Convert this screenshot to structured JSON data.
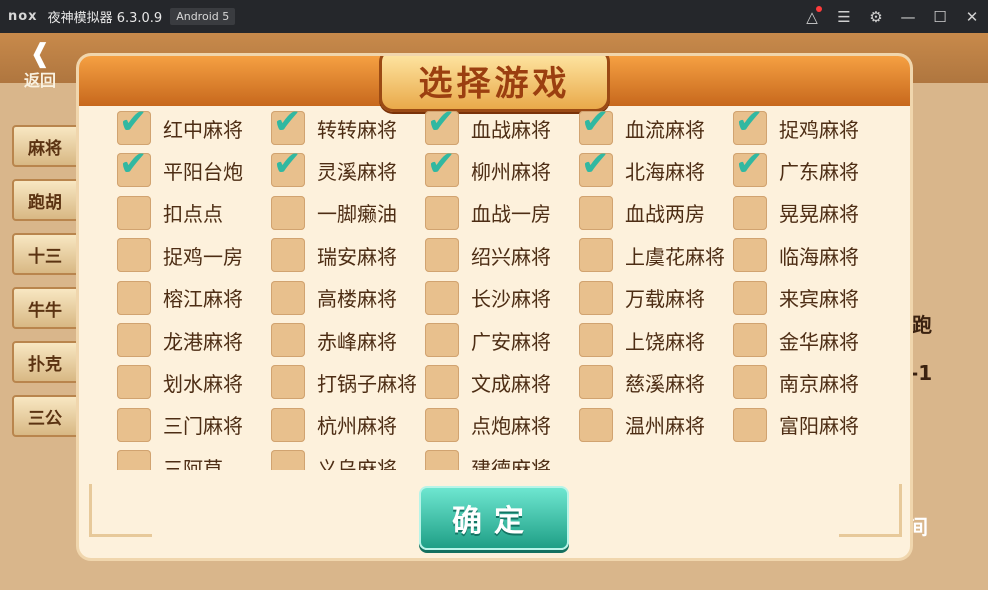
{
  "window": {
    "logo": "nox",
    "title": "夜神模拟器 6.3.0.9",
    "android_badge": "Android 5",
    "controls": [
      "shirt-icon",
      "menu-icon",
      "gear-icon",
      "minimize-icon",
      "maximize-icon",
      "close-icon"
    ]
  },
  "game": {
    "back_label": "返回",
    "side_tabs": [
      "麻将",
      "跑胡",
      "十三",
      "牛牛",
      "扑克",
      "三公"
    ],
    "right_fragments": [
      "跑",
      "-1",
      "间"
    ]
  },
  "dialog": {
    "title": "选择游戏",
    "confirm_label": "确定",
    "options": [
      {
        "label": "红中麻将",
        "checked": true
      },
      {
        "label": "转转麻将",
        "checked": true
      },
      {
        "label": "血战麻将",
        "checked": true
      },
      {
        "label": "血流麻将",
        "checked": true
      },
      {
        "label": "捉鸡麻将",
        "checked": true
      },
      {
        "label": "平阳台炮",
        "checked": true
      },
      {
        "label": "灵溪麻将",
        "checked": true
      },
      {
        "label": "柳州麻将",
        "checked": true
      },
      {
        "label": "北海麻将",
        "checked": true
      },
      {
        "label": "广东麻将",
        "checked": true
      },
      {
        "label": "扣点点",
        "checked": false
      },
      {
        "label": "一脚癞油",
        "checked": false
      },
      {
        "label": "血战一房",
        "checked": false
      },
      {
        "label": "血战两房",
        "checked": false
      },
      {
        "label": "晃晃麻将",
        "checked": false
      },
      {
        "label": "捉鸡一房",
        "checked": false
      },
      {
        "label": "瑞安麻将",
        "checked": false
      },
      {
        "label": "绍兴麻将",
        "checked": false
      },
      {
        "label": "上虞花麻将",
        "checked": false
      },
      {
        "label": "临海麻将",
        "checked": false
      },
      {
        "label": "榕江麻将",
        "checked": false
      },
      {
        "label": "高楼麻将",
        "checked": false
      },
      {
        "label": "长沙麻将",
        "checked": false
      },
      {
        "label": "万载麻将",
        "checked": false
      },
      {
        "label": "来宾麻将",
        "checked": false
      },
      {
        "label": "龙港麻将",
        "checked": false
      },
      {
        "label": "赤峰麻将",
        "checked": false
      },
      {
        "label": "广安麻将",
        "checked": false
      },
      {
        "label": "上饶麻将",
        "checked": false
      },
      {
        "label": "金华麻将",
        "checked": false
      },
      {
        "label": "划水麻将",
        "checked": false
      },
      {
        "label": "打锅子麻将",
        "checked": false
      },
      {
        "label": "文成麻将",
        "checked": false
      },
      {
        "label": "慈溪麻将",
        "checked": false
      },
      {
        "label": "南京麻将",
        "checked": false
      },
      {
        "label": "三门麻将",
        "checked": false
      },
      {
        "label": "杭州麻将",
        "checked": false
      },
      {
        "label": "点炮麻将",
        "checked": false
      },
      {
        "label": "温州麻将",
        "checked": false
      },
      {
        "label": "富阳麻将",
        "checked": false
      },
      {
        "label": "三阿草",
        "checked": false
      },
      {
        "label": "义乌麻将",
        "checked": false
      },
      {
        "label": "建德麻将",
        "checked": false
      }
    ]
  },
  "colors": {
    "checkbox": "#e8c08d",
    "check": "#31b8a1",
    "dialog_bg": "#fdf1dc",
    "confirm": "#2fb79c"
  }
}
